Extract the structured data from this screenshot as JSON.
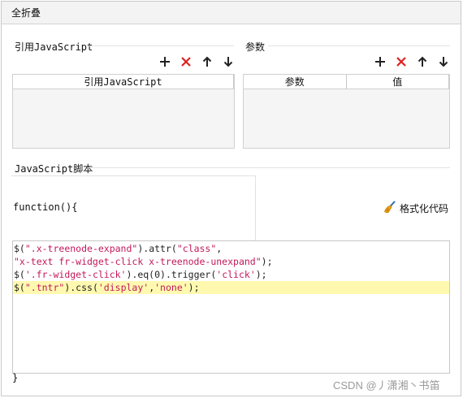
{
  "window": {
    "title": "全折叠"
  },
  "refs_section": {
    "label": "引用JavaScript",
    "table_header": "引用JavaScript"
  },
  "params_section": {
    "label": "参数",
    "col_param": "参数",
    "col_value": "值"
  },
  "script_section": {
    "label": "JavaScript脚本",
    "function_head": "function(){",
    "function_tail": "}",
    "format_button": "格式化代码"
  },
  "toolbar": {
    "icons": [
      "plus-icon",
      "delete-x-icon",
      "arrow-up-icon",
      "arrow-down-icon"
    ],
    "colors": {
      "delete": "#e02020",
      "default": "#222222"
    }
  },
  "code": {
    "lines": [
      {
        "text": "$(\".x-treenode-expand\").attr(\"class\",",
        "highlight": false
      },
      {
        "text": "\"x-text fr-widget-click x-treenode-unexpand\");",
        "highlight": false
      },
      {
        "text": "$('.fr-widget-click').eq(0).trigger('click');",
        "highlight": false
      },
      {
        "text": "$(\".tntr\").css('display','none');",
        "highlight": true
      }
    ],
    "highlight_color": "#fff9b0",
    "string_color": "#c2185b"
  },
  "watermark": "CSDN @丿潇湘丶书笛"
}
